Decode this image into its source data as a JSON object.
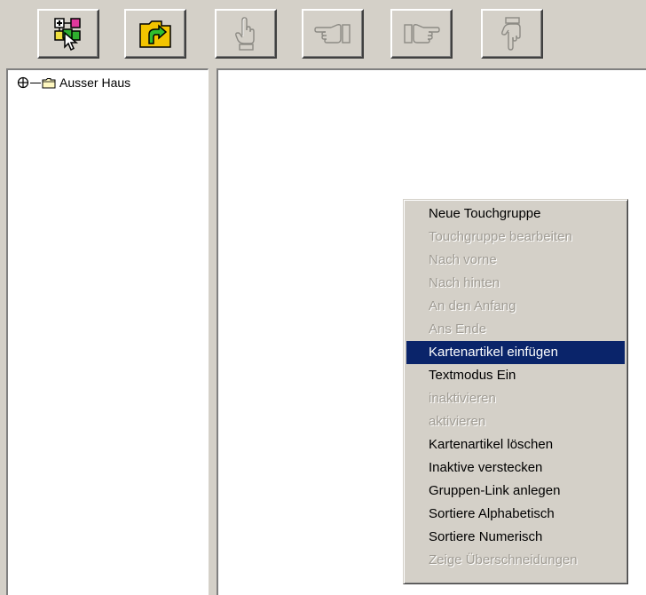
{
  "toolbar": {
    "buttons": [
      {
        "name": "select-tool",
        "icon": "colored-squares-pointer-icon",
        "enabled": true
      },
      {
        "name": "open-folder",
        "icon": "folder-arrow-icon",
        "enabled": true
      },
      {
        "name": "touch-hand",
        "icon": "hand-pointing-up-icon",
        "enabled": false
      },
      {
        "name": "hand-left",
        "icon": "hand-pointing-left-icon",
        "enabled": false
      },
      {
        "name": "hand-right",
        "icon": "hand-pointing-right-icon",
        "enabled": false
      },
      {
        "name": "hand-down",
        "icon": "hand-pointing-down-icon",
        "enabled": false
      }
    ]
  },
  "tree": {
    "items": [
      {
        "label": "Ausser Haus",
        "icon": "folder-icon"
      }
    ]
  },
  "context_menu": {
    "items": [
      {
        "label": "Neue Touchgruppe",
        "enabled": true
      },
      {
        "label": "Touchgruppe bearbeiten",
        "enabled": false
      },
      {
        "label": "Nach vorne",
        "enabled": false
      },
      {
        "label": "Nach hinten",
        "enabled": false
      },
      {
        "label": "An den Anfang",
        "enabled": false
      },
      {
        "label": "Ans Ende",
        "enabled": false
      },
      {
        "label": "Kartenartikel einfügen",
        "enabled": true,
        "selected": true
      },
      {
        "label": "Textmodus Ein",
        "enabled": true
      },
      {
        "label": "inaktivieren",
        "enabled": false
      },
      {
        "label": "aktivieren",
        "enabled": false
      },
      {
        "label": "Kartenartikel löschen",
        "enabled": true
      },
      {
        "label": "Inaktive verstecken",
        "enabled": true
      },
      {
        "label": "Gruppen-Link anlegen",
        "enabled": true
      },
      {
        "label": "Sortiere Alphabetisch",
        "enabled": true
      },
      {
        "label": "Sortiere Numerisch",
        "enabled": true
      },
      {
        "label": "Zeige Überschneidungen",
        "enabled": false
      }
    ]
  },
  "colors": {
    "face": "#d4d0c8",
    "highlight": "#0a246a",
    "disabled_text": "#a09c94",
    "window": "#ffffff"
  }
}
